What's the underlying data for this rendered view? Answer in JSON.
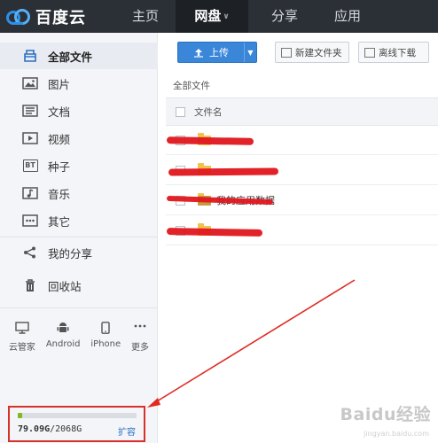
{
  "app": {
    "logo_text": "百度云"
  },
  "nav": {
    "items": [
      {
        "label": "主页",
        "active": false
      },
      {
        "label": "网盘",
        "active": true,
        "has_caret": true
      },
      {
        "label": "分享",
        "active": false
      },
      {
        "label": "应用",
        "active": false
      }
    ]
  },
  "sidebar": {
    "items": [
      {
        "label": "全部文件",
        "icon": "all-files-icon",
        "active": true
      },
      {
        "label": "图片",
        "icon": "image-icon"
      },
      {
        "label": "文档",
        "icon": "document-icon"
      },
      {
        "label": "视频",
        "icon": "video-icon"
      },
      {
        "label": "种子",
        "icon": "torrent-icon",
        "icon_text": "BT"
      },
      {
        "label": "音乐",
        "icon": "music-icon"
      },
      {
        "label": "其它",
        "icon": "other-icon"
      }
    ],
    "share_label": "我的分享",
    "recycle_label": "回收站",
    "devices": [
      {
        "label": "云管家",
        "icon": "desktop-icon"
      },
      {
        "label": "Android",
        "icon": "android-icon"
      },
      {
        "label": "iPhone",
        "icon": "iphone-icon"
      },
      {
        "label": "更多",
        "icon": "more-icon"
      }
    ],
    "quota": {
      "used": "79.09G",
      "total": "/2068G",
      "expand_label": "扩容",
      "used_fraction": 0.04
    }
  },
  "toolbar": {
    "upload_label": "上传",
    "new_folder_label": "新建文件夹",
    "offline_download_label": "离线下载"
  },
  "file_list": {
    "breadcrumb": "全部文件",
    "column_name": "文件名",
    "rows": [
      {
        "name": ""
      },
      {
        "name": ""
      },
      {
        "name": "我的应用数据"
      },
      {
        "name": ""
      }
    ]
  },
  "watermark": {
    "text": "Baidu经验",
    "sub": "jingyan.baidu.com"
  },
  "colors": {
    "nav_bg": "#2b2f36",
    "accent_blue": "#3a86d8",
    "quota_green": "#7fba24",
    "annotation_red": "#d9302b"
  }
}
